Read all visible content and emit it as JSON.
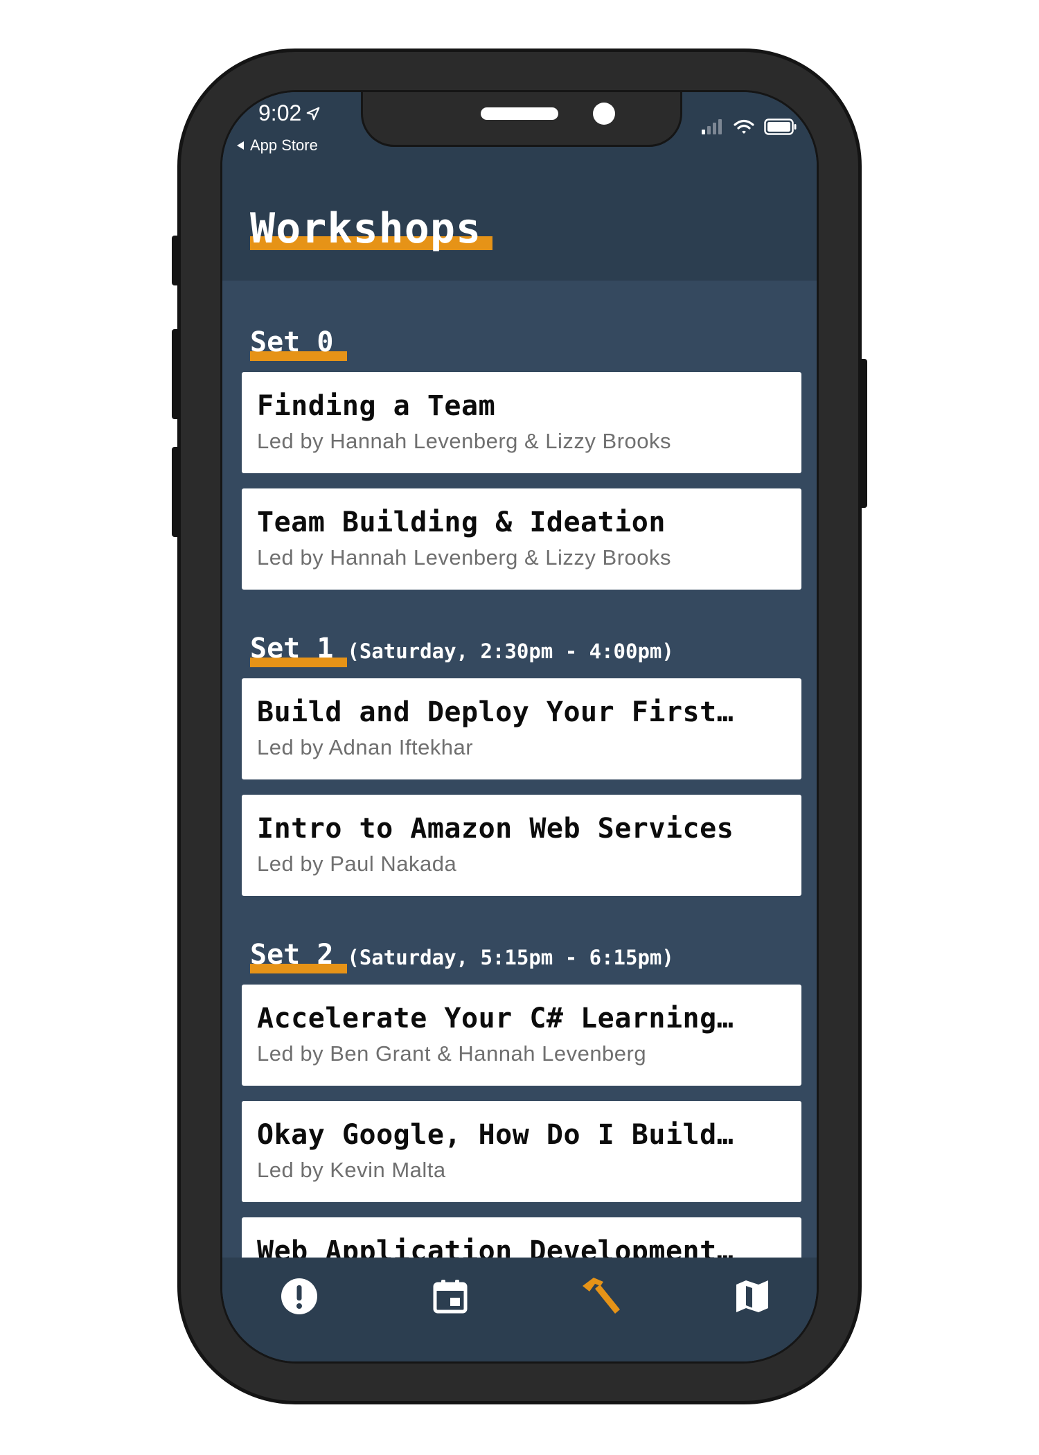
{
  "status_bar": {
    "time": "9:02",
    "back_label": "App Store"
  },
  "header": {
    "title": "Workshops"
  },
  "colors": {
    "accent": "#e69317",
    "header_bg": "#2c3e50",
    "content_bg": "#35495f",
    "card_bg": "#ffffff"
  },
  "sets": [
    {
      "label": "Set 0",
      "time": "",
      "workshops": [
        {
          "title": "Finding a Team",
          "leader": "Led by Hannah Levenberg & Lizzy Brooks"
        },
        {
          "title": "Team Building & Ideation",
          "leader": "Led by Hannah Levenberg & Lizzy Brooks"
        }
      ]
    },
    {
      "label": "Set 1",
      "time": "(Saturday, 2:30pm - 4:00pm)",
      "workshops": [
        {
          "title": "Build and Deploy Your First…",
          "leader": "Led by Adnan Iftekhar"
        },
        {
          "title": "Intro to Amazon Web Services",
          "leader": "Led by Paul Nakada"
        }
      ]
    },
    {
      "label": "Set 2",
      "time": "(Saturday, 5:15pm - 6:15pm)",
      "workshops": [
        {
          "title": "Accelerate Your C# Learning…",
          "leader": "Led by Ben Grant & Hannah Levenberg"
        },
        {
          "title": "Okay Google, How Do I Build…",
          "leader": "Led by Kevin Malta"
        },
        {
          "title": "Web Application Development…",
          "leader": ""
        }
      ]
    }
  ],
  "tabbar": {
    "items": [
      {
        "icon": "alert-icon",
        "active": false
      },
      {
        "icon": "calendar-icon",
        "active": false
      },
      {
        "icon": "hammer-icon",
        "active": true
      },
      {
        "icon": "map-icon",
        "active": false
      }
    ]
  }
}
